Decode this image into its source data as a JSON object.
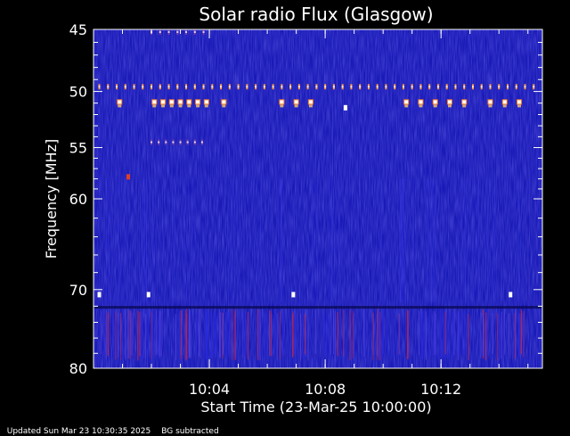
{
  "chart_data": {
    "type": "heatmap",
    "title": "Solar radio Flux (Glasgow)",
    "xlabel": "Start Time (23-Mar-25 10:00:00)",
    "ylabel": "Frequency [MHz]",
    "x_unit": "minutes",
    "xlim": [
      0,
      15.5
    ],
    "ylim": [
      45,
      80
    ],
    "y_scale": "log",
    "x_ticks": [
      {
        "value": 4,
        "label": "10:04"
      },
      {
        "value": 8,
        "label": "10:08"
      },
      {
        "value": 12,
        "label": "10:12"
      }
    ],
    "x_minor_tick_step": 1,
    "y_ticks": [
      {
        "value": 45,
        "label": "45"
      },
      {
        "value": 50,
        "label": "50"
      },
      {
        "value": 55,
        "label": "55"
      },
      {
        "value": 60,
        "label": "60"
      },
      {
        "value": 70,
        "label": "70"
      },
      {
        "value": 80,
        "label": "80"
      }
    ],
    "y_minor_ticks": [
      46,
      47,
      48,
      49,
      51,
      52,
      53,
      54,
      56,
      57,
      58,
      59,
      62,
      64,
      66,
      68,
      72,
      74,
      76,
      78
    ],
    "grid": false,
    "background_color": "#1a1ab8",
    "features": [
      {
        "kind": "band",
        "freq": 49.6,
        "x_from": 0.2,
        "x_to": 15.4,
        "period": 0.3,
        "color": "#ff9933"
      },
      {
        "kind": "band",
        "freq": 45.2,
        "x_from": 2.0,
        "x_to": 3.8,
        "period": 0.3,
        "color": "#7a3fa0"
      },
      {
        "kind": "band",
        "freq": 54.5,
        "x_from": 2.0,
        "x_to": 3.8,
        "period": 0.25,
        "color": "#7a3fa0"
      },
      {
        "kind": "hot",
        "freq": 50.9,
        "x": [
          0.9,
          2.1,
          2.4,
          2.7,
          3.0,
          3.3,
          3.6,
          3.9,
          4.5,
          6.5,
          7.0,
          7.5,
          10.8,
          11.3,
          11.8,
          12.3,
          12.8,
          13.7,
          14.2,
          14.7
        ]
      },
      {
        "kind": "dot",
        "freq": 51.4,
        "x": [
          8.7
        ],
        "color": "#ffffff"
      },
      {
        "kind": "dot",
        "freq": 70.6,
        "x": [
          0.2,
          1.9,
          6.9,
          14.4
        ],
        "color": "#ffffff"
      },
      {
        "kind": "dot",
        "freq": 57.8,
        "x": [
          1.2
        ],
        "color": "#e04020"
      }
    ],
    "broadband_region": {
      "freq_from": 72.3,
      "freq_to": 79.0
    }
  },
  "status_bar": {
    "updated": "Updated Sun Mar 23 10:30:35 2025",
    "note": "BG subtracted"
  }
}
